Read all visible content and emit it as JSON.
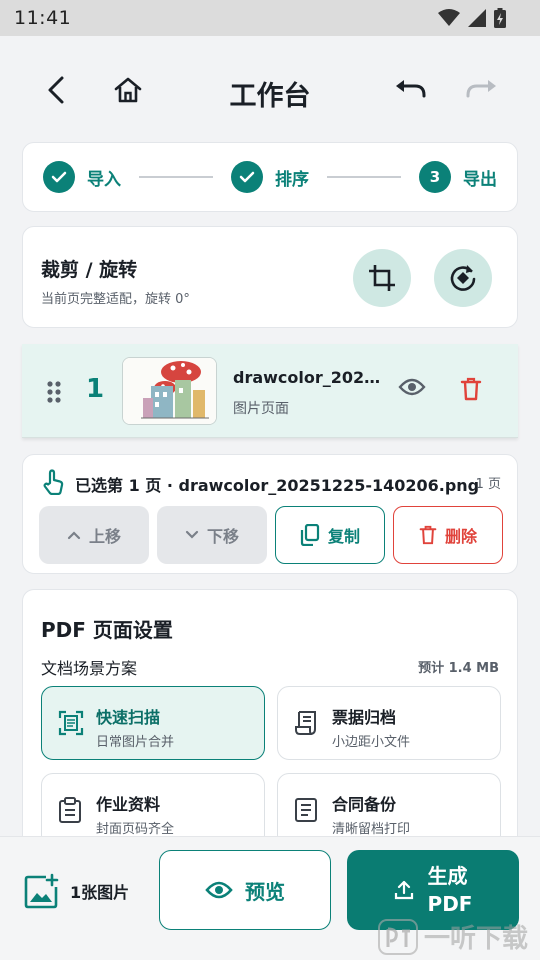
{
  "status_bar": {
    "time": "11:41"
  },
  "header": {
    "title": "工作台"
  },
  "stepper": {
    "steps": [
      {
        "label": "导入",
        "state": "done"
      },
      {
        "label": "排序",
        "state": "done"
      },
      {
        "number": "3",
        "label": "导出",
        "state": "current"
      }
    ]
  },
  "crop": {
    "title": "裁剪 / 旋转",
    "subtitle": "当前页完整适配，旋转 0°"
  },
  "page_item": {
    "index": "1",
    "filename": "drawcolor_2025…",
    "type_label": "图片页面"
  },
  "selection": {
    "text": "已选第 1 页 · drawcolor_20251225-140206.png",
    "count": "1 页",
    "actions": {
      "move_up": "上移",
      "move_down": "下移",
      "copy": "复制",
      "delete": "删除"
    }
  },
  "pdf_settings": {
    "title": "PDF 页面设置",
    "scheme_label": "文档场景方案",
    "estimate": "预计 1.4 MB",
    "options": [
      {
        "name": "快速扫描",
        "desc": "日常图片合并",
        "selected": true,
        "icon": "scan-icon"
      },
      {
        "name": "票据归档",
        "desc": "小边距小文件",
        "selected": false,
        "icon": "receipt-icon"
      },
      {
        "name": "作业资料",
        "desc": "封面页码齐全",
        "selected": false,
        "icon": "clipboard-icon"
      },
      {
        "name": "合同备份",
        "desc": "清晰留档打印",
        "selected": false,
        "icon": "document-icon"
      }
    ]
  },
  "bottom_bar": {
    "image_count": "1张图片",
    "preview_label": "预览",
    "generate_line1": "生成",
    "generate_line2": "PDF"
  },
  "watermark": "一听下载",
  "colors": {
    "accent": "#0b8178",
    "danger": "#e0433b",
    "accent_light": "#e6f4f1"
  }
}
